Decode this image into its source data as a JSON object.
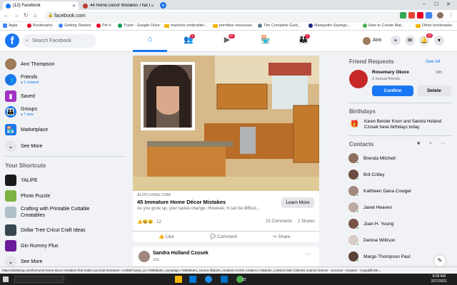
{
  "browser": {
    "tabs": [
      {
        "label": "(12) Facebook"
      },
      {
        "label": "44 Home Decor Mistakes That Kit"
      }
    ],
    "address": "facebook.com",
    "bookmarks": [
      "Apps",
      "Bookmarks",
      "Getting Started",
      "Pin it",
      "Trash - Google Drive",
      "machine embroider...",
      "primitive resources",
      "The Complete Guid...",
      "Marquette Savings...",
      "How to Create Mat...",
      "Other bookmarks"
    ],
    "status_url": "https://alotliving.com/homo/44-home-decor-mistakes-that-make-you-look-immature-~14089?camp_id=748568utm_campaign=748568utm_source=fb&utm_medium=Cemb contains n.55&utm_content=Oak Cabinets Joanna Gaines - Success - Keywee - Copy&fbclid=..."
  },
  "fb": {
    "search_placeholder": "Search Facebook",
    "badges": {
      "friends": "1",
      "watch": "9+",
      "groups": "7",
      "notifications": "12"
    },
    "user_short": "Ann",
    "left": {
      "user": "Ann Thompson",
      "friends": "Friends",
      "friends_sub": "● 1 request",
      "saved": "Saved",
      "groups": "Groups",
      "groups_sub": "● 7 new",
      "marketplace": "Marketplace",
      "see_more": "See More",
      "shortcuts_title": "Your Shortcuts",
      "shortcuts": [
        "YALIFE",
        "Photo Puzzle",
        "Crafting with Printable Cuttable Creatables",
        "Dollar Tree Cricut Craft Ideas",
        "Gin Rummy Plus"
      ],
      "see_more2": "See More"
    },
    "post": {
      "domain": "ALOTLIVING.COM",
      "title": "45 Immature Home Décor Mistakes",
      "desc": "As you grow up, your tastes change. However, it can be difficul...",
      "learn_more": "Learn More",
      "reaction_count": "12",
      "comments": "23 Comments",
      "shares": "2 Shares",
      "like": "Like",
      "comment": "Comment",
      "share": "Share"
    },
    "post2": {
      "author": "Sandra Holland Czosek",
      "time": "11h · ",
      "more": "···"
    },
    "right": {
      "fr_title": "Friend Requests",
      "see_all": "See All",
      "fr_name": "Rosemary Okore",
      "fr_time": "18h",
      "fr_mutual": "2 mutual friends",
      "confirm": "Confirm",
      "delete": "Delete",
      "bday_title": "Birthdays",
      "bday_text": "Karen Bender Knorr and Sandra Holland Czosek have birthdays today.",
      "contacts_title": "Contacts",
      "contacts": [
        "Brenda Mitchell",
        "Brit Crilley",
        "Kathleen Dana Cowger",
        "Janet Heaven",
        "Joan H. Young",
        "Denise Willison",
        "Margo Thompson Paul"
      ]
    },
    "taskbar_time": "8:06 AM",
    "taskbar_date": "2/27/2021",
    "taskbar_badge": "22"
  },
  "colors": {
    "fb_blue": "#1877f2",
    "badge_red": "#e41e3f",
    "online": "#31a24c"
  }
}
